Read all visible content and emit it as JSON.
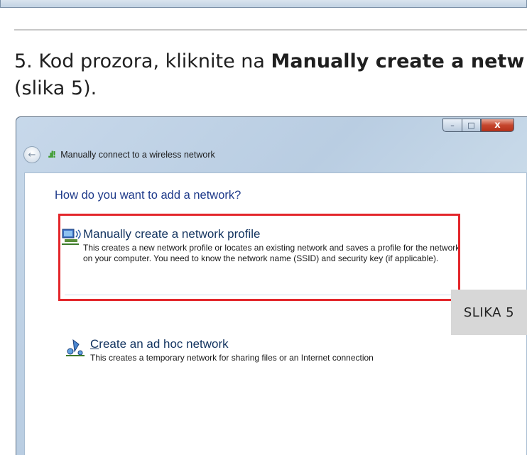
{
  "article": {
    "step_prefix": "5. Kod prozora, kliknite na ",
    "step_bold": "Manually create a netw",
    "step_suffix": "(slika 5).",
    "figure_label": "SLIKA 5"
  },
  "window": {
    "nav_title": "Manually connect to a wireless network",
    "caption_buttons": {
      "minimize": "–",
      "maximize": "□",
      "close": "x"
    },
    "heading": "How do you want to add a network?",
    "options": [
      {
        "title": "Manually create a network profile",
        "description": "This creates a new network profile or locates an existing network and saves a profile for the network on your computer. You need to know the network name (SSID) and security key (if applicable).",
        "icon": "network-profile-icon",
        "highlighted": true
      },
      {
        "title_underlined": "C",
        "title": "reate an ad hoc network",
        "description": "This creates a temporary network for sharing files or an Internet connection",
        "icon": "ad-hoc-network-icon",
        "highlighted": false
      }
    ]
  },
  "colors": {
    "highlight_border": "#e3262b",
    "heading": "#1e3a8a",
    "title": "#12335f"
  }
}
